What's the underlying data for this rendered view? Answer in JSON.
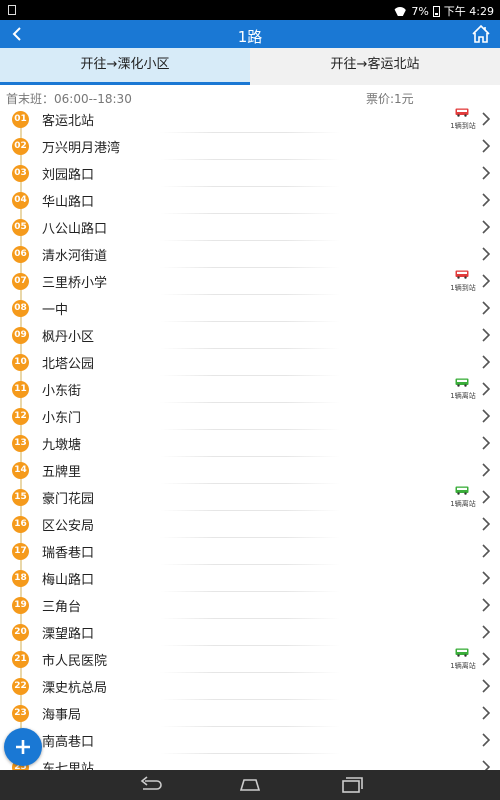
{
  "status_bar": {
    "battery": "7%",
    "time": "下午 4:29"
  },
  "header": {
    "title": "1路"
  },
  "tabs": [
    {
      "label": "开往→溧化小区",
      "active": true
    },
    {
      "label": "开往→客运北站",
      "active": false
    }
  ],
  "info": {
    "hours": "首末班：06:00--18:30",
    "fare": "票价:1元"
  },
  "colors": {
    "primary": "#1a78d4",
    "stop_badge": "#f59a1b",
    "bus_arriving": "#e23c3c",
    "bus_leaving": "#3aae3a"
  },
  "stops": [
    {
      "num": "01",
      "name": "客运北站",
      "bus": {
        "text": "1辆到站",
        "status": "arriving"
      }
    },
    {
      "num": "02",
      "name": "万兴明月港湾"
    },
    {
      "num": "03",
      "name": "刘园路口"
    },
    {
      "num": "04",
      "name": "华山路口"
    },
    {
      "num": "05",
      "name": "八公山路口"
    },
    {
      "num": "06",
      "name": "清水河街道"
    },
    {
      "num": "07",
      "name": "三里桥小学",
      "bus": {
        "text": "1辆到站",
        "status": "arriving"
      }
    },
    {
      "num": "08",
      "name": "一中"
    },
    {
      "num": "09",
      "name": "枫丹小区"
    },
    {
      "num": "10",
      "name": "北塔公园"
    },
    {
      "num": "11",
      "name": "小东街",
      "bus": {
        "text": "1辆离站",
        "status": "leaving"
      }
    },
    {
      "num": "12",
      "name": "小东门"
    },
    {
      "num": "13",
      "name": "九墩塘"
    },
    {
      "num": "14",
      "name": "五牌里"
    },
    {
      "num": "15",
      "name": "豪门花园",
      "bus": {
        "text": "1辆离站",
        "status": "leaving"
      }
    },
    {
      "num": "16",
      "name": "区公安局"
    },
    {
      "num": "17",
      "name": "瑞香巷口"
    },
    {
      "num": "18",
      "name": "梅山路口"
    },
    {
      "num": "19",
      "name": "三角台"
    },
    {
      "num": "20",
      "name": "溧望路口"
    },
    {
      "num": "21",
      "name": "市人民医院",
      "bus": {
        "text": "1辆离站",
        "status": "leaving"
      }
    },
    {
      "num": "22",
      "name": "溧史杭总局"
    },
    {
      "num": "23",
      "name": "海事局"
    },
    {
      "num": "24",
      "name": "南高巷口"
    },
    {
      "num": "25",
      "name": "东七里站"
    }
  ],
  "icons": {
    "back": "chevron-left-icon",
    "home": "home-icon",
    "row_arrow": "chevron-right-icon",
    "bus": "bus-icon",
    "fab": "plus-icon"
  }
}
